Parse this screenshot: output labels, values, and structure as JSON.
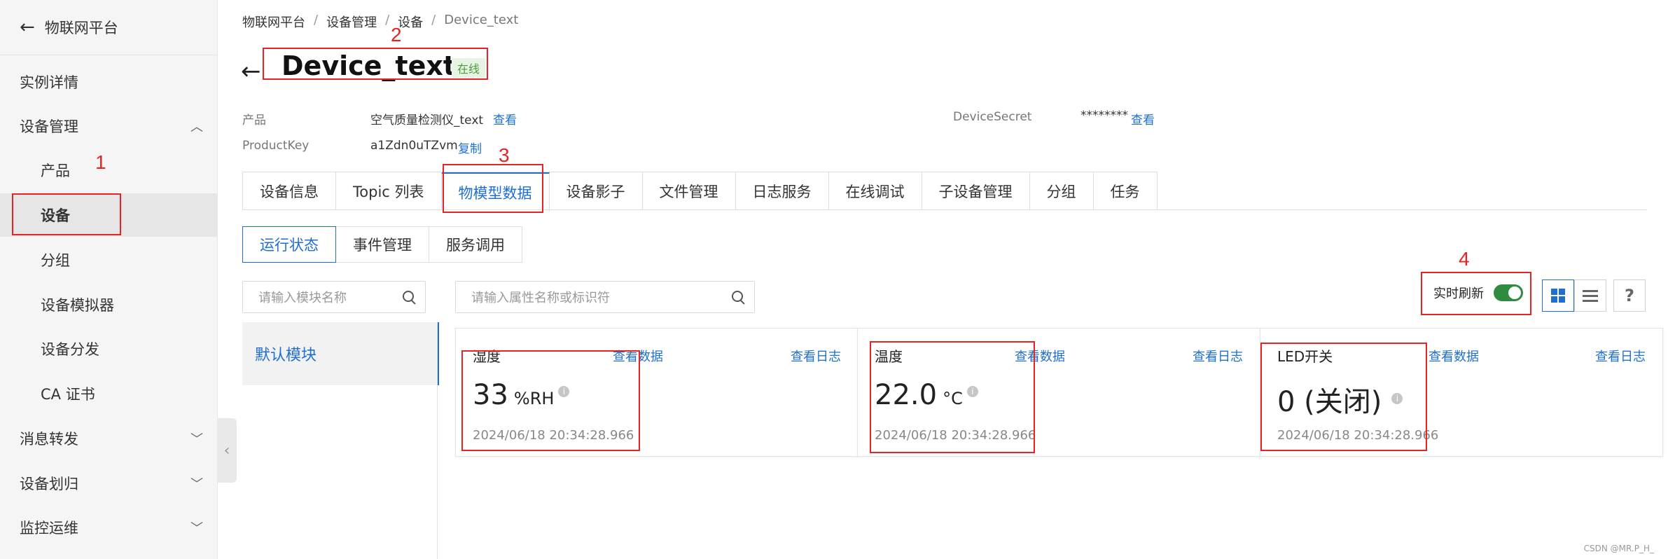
{
  "sidebar": {
    "back_icon": "arrow-left-icon",
    "title": "物联网平台",
    "items": [
      {
        "label": "实例详情"
      },
      {
        "label": "设备管理"
      },
      {
        "label": "产品"
      },
      {
        "label": "设备"
      },
      {
        "label": "分组"
      },
      {
        "label": "设备模拟器"
      },
      {
        "label": "设备分发"
      },
      {
        "label": "CA 证书"
      },
      {
        "label": "消息转发"
      },
      {
        "label": "设备划归"
      },
      {
        "label": "监控运维"
      }
    ]
  },
  "breadcrumb": [
    "物联网平台",
    "设备管理",
    "设备",
    "Device_text"
  ],
  "breadcrumb_sep": "/",
  "header": {
    "title": "Device_text",
    "status": "在线"
  },
  "meta": {
    "product_label": "产品",
    "product_value": "空气质量检测仪_text",
    "product_link": "查看",
    "productkey_label": "ProductKey",
    "productkey_value": "a1Zdn0uTZvm",
    "productkey_link": "复制",
    "secret_label": "DeviceSecret",
    "secret_value": "********",
    "secret_link": "查看"
  },
  "tabs": [
    "设备信息",
    "Topic 列表",
    "物模型数据",
    "设备影子",
    "文件管理",
    "日志服务",
    "在线调试",
    "子设备管理",
    "分组",
    "任务"
  ],
  "subtabs": [
    "运行状态",
    "事件管理",
    "服务调用"
  ],
  "module_search_placeholder": "请输入模块名称",
  "prop_search_placeholder": "请输入属性名称或标识符",
  "default_module": "默认模块",
  "realtime_label": "实时刷新",
  "realtime_on": true,
  "cards": [
    {
      "name": "湿度",
      "value": "33",
      "unit": "%RH",
      "time": "2024/06/18 20:34:28.966",
      "view_data": "查看数据",
      "view_log": "查看日志"
    },
    {
      "name": "温度",
      "value": "22.0",
      "unit": "°C",
      "time": "2024/06/18 20:34:28.966",
      "view_data": "查看数据",
      "view_log": "查看日志"
    },
    {
      "name": "LED开关",
      "value": "0 (关闭)",
      "unit": "",
      "time": "2024/06/18 20:34:28.966",
      "view_data": "查看数据",
      "view_log": "查看日志"
    }
  ],
  "annotations": [
    "1",
    "2",
    "3",
    "4"
  ],
  "watermark": "CSDN @MR.P_H_",
  "colors": {
    "accent": "#1f6fd1",
    "annotation": "#e32525",
    "toggle_on": "#2e8b3f",
    "status_bg": "#e7f4e4"
  }
}
